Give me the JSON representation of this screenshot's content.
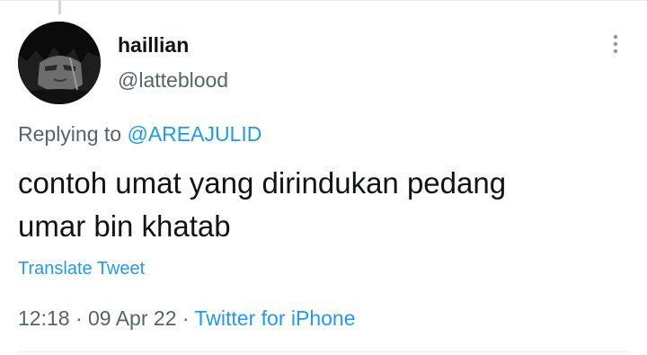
{
  "tweet": {
    "author": {
      "display_name": "haillian",
      "handle": "@latteblood"
    },
    "reply": {
      "prefix": "Replying to ",
      "mention": "@AREAJULID"
    },
    "text_line_1": "contoh umat yang dirindukan pedang",
    "text_line_2": "umar bin khatab",
    "translate_label": "Translate Tweet",
    "meta": {
      "time": "12:18",
      "separator_1": " · ",
      "date": "09 Apr 22",
      "separator_2": " · ",
      "source": "Twitter for iPhone"
    }
  },
  "icons": {
    "more": "more-vertical-icon",
    "avatar": "avatar"
  },
  "colors": {
    "accent": "#1d9bf0",
    "text_primary": "#0f1419",
    "text_secondary": "#536471",
    "divider": "#e6ecf0"
  }
}
